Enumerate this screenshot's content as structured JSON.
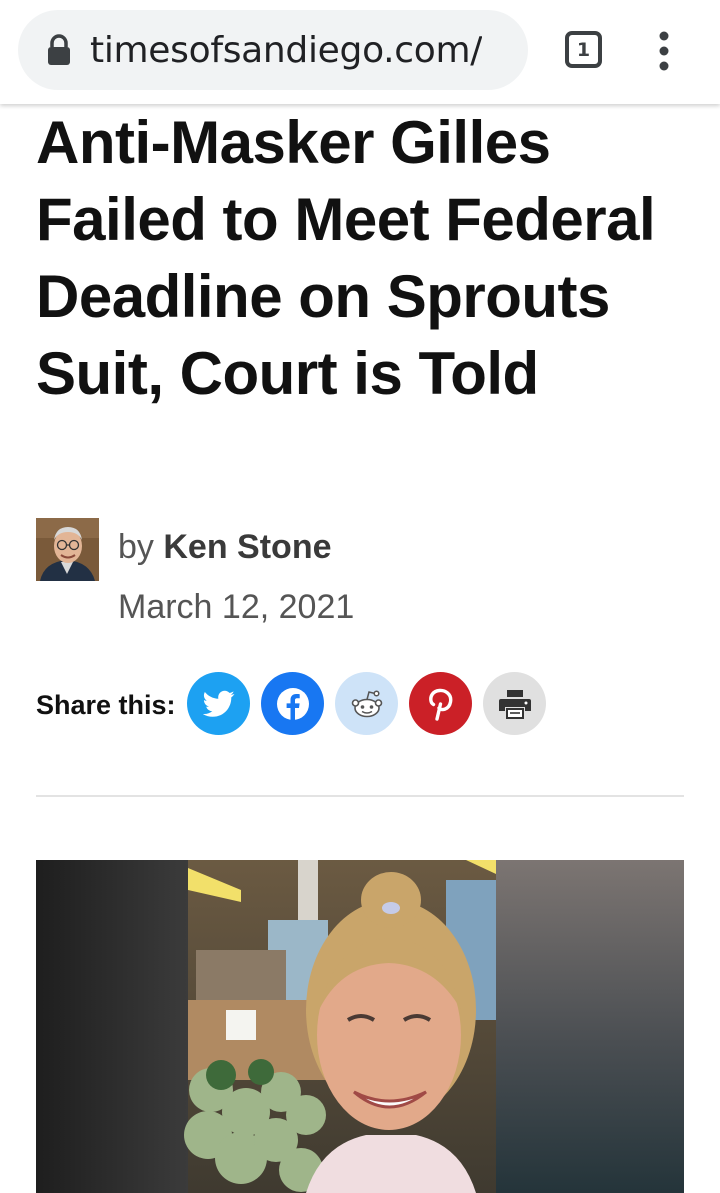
{
  "browser": {
    "url": "timesofsandiego.com/",
    "tab_count": "1",
    "icons": {
      "lock": "lock-icon",
      "menu": "more-vert-icon"
    }
  },
  "article": {
    "headline": "Anti-Masker Gilles Failed to Meet Fed­eral Deadline on Sprouts Suit, Court is Told",
    "byline_prefix": "by",
    "author": "Ken Stone",
    "date": "March 12, 2021"
  },
  "share": {
    "label": "Share this:",
    "buttons": [
      {
        "name": "twitter",
        "icon": "twitter-icon",
        "color": "#1da1f2"
      },
      {
        "name": "facebook",
        "icon": "facebook-icon",
        "color": "#1877f2"
      },
      {
        "name": "reddit",
        "icon": "reddit-icon",
        "color": "#cee3f8"
      },
      {
        "name": "pinterest",
        "icon": "pinterest-icon",
        "color": "#cb2027"
      },
      {
        "name": "print",
        "icon": "print-icon",
        "color": "#e0e0e0"
      }
    ]
  }
}
